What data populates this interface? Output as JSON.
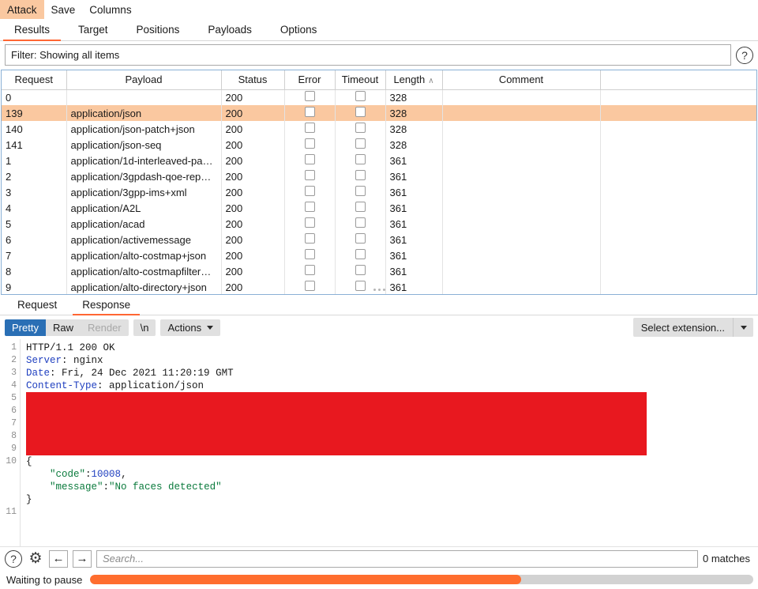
{
  "menubar": {
    "items": [
      {
        "label": "Attack",
        "active": true
      },
      {
        "label": "Save",
        "active": false
      },
      {
        "label": "Columns",
        "active": false
      }
    ]
  },
  "tabs": {
    "items": [
      {
        "label": "Results",
        "active": true
      },
      {
        "label": "Target",
        "active": false
      },
      {
        "label": "Positions",
        "active": false
      },
      {
        "label": "Payloads",
        "active": false
      },
      {
        "label": "Options",
        "active": false
      }
    ]
  },
  "filter": {
    "text": "Filter: Showing all items",
    "help_icon": "question-mark-icon",
    "help_glyph": "?"
  },
  "results_table": {
    "columns": [
      "Request",
      "Payload",
      "Status",
      "Error",
      "Timeout",
      "Length",
      "Comment"
    ],
    "sorted_column": "Length",
    "sort_caret": "∧",
    "rows": [
      {
        "request": "0",
        "payload": "",
        "status": "200",
        "length": "328",
        "comment": "",
        "selected": false
      },
      {
        "request": "139",
        "payload": "application/json",
        "status": "200",
        "length": "328",
        "comment": "",
        "selected": true
      },
      {
        "request": "140",
        "payload": "application/json-patch+json",
        "status": "200",
        "length": "328",
        "comment": "",
        "selected": false
      },
      {
        "request": "141",
        "payload": "application/json-seq",
        "status": "200",
        "length": "328",
        "comment": "",
        "selected": false
      },
      {
        "request": "1",
        "payload": "application/1d-interleaved-pa…",
        "status": "200",
        "length": "361",
        "comment": "",
        "selected": false
      },
      {
        "request": "2",
        "payload": "application/3gpdash-qoe-rep…",
        "status": "200",
        "length": "361",
        "comment": "",
        "selected": false
      },
      {
        "request": "3",
        "payload": "application/3gpp-ims+xml",
        "status": "200",
        "length": "361",
        "comment": "",
        "selected": false
      },
      {
        "request": "4",
        "payload": "application/A2L",
        "status": "200",
        "length": "361",
        "comment": "",
        "selected": false
      },
      {
        "request": "5",
        "payload": "application/acad",
        "status": "200",
        "length": "361",
        "comment": "",
        "selected": false
      },
      {
        "request": "6",
        "payload": "application/activemessage",
        "status": "200",
        "length": "361",
        "comment": "",
        "selected": false
      },
      {
        "request": "7",
        "payload": "application/alto-costmap+json",
        "status": "200",
        "length": "361",
        "comment": "",
        "selected": false
      },
      {
        "request": "8",
        "payload": "application/alto-costmapfilter…",
        "status": "200",
        "length": "361",
        "comment": "",
        "selected": false
      },
      {
        "request": "9",
        "payload": "application/alto-directory+json",
        "status": "200",
        "length": "361",
        "comment": "",
        "selected": false
      }
    ]
  },
  "message_tabs": {
    "items": [
      {
        "label": "Request",
        "active": false
      },
      {
        "label": "Response",
        "active": true
      }
    ]
  },
  "editor_toolbar": {
    "pretty": "Pretty",
    "raw": "Raw",
    "render": "Render",
    "newline": "\\n",
    "actions": "Actions",
    "select_extension": "Select extension..."
  },
  "response": {
    "lines": [
      {
        "num": "1",
        "type": "status",
        "text": "HTTP/1.1 200 OK"
      },
      {
        "num": "2",
        "type": "header",
        "name": "Server",
        "value": " nginx"
      },
      {
        "num": "3",
        "type": "header",
        "name": "Date",
        "value": " Fri, 24 Dec 2021 11:20:19 GMT"
      },
      {
        "num": "4",
        "type": "header",
        "name": "Content-Type",
        "value": " application/json"
      },
      {
        "num": "5",
        "type": "redacted",
        "text": ""
      },
      {
        "num": "6",
        "type": "redacted",
        "text": ""
      },
      {
        "num": "7",
        "type": "redacted",
        "text": ""
      },
      {
        "num": "8",
        "type": "redacted",
        "text": ""
      },
      {
        "num": "9",
        "type": "redacted",
        "text": ""
      },
      {
        "num": "10",
        "type": "plain",
        "text": "{"
      },
      {
        "num": "",
        "type": "json_num",
        "key": "\"code\"",
        "sep": ":",
        "value": "10008",
        "tail": ","
      },
      {
        "num": "",
        "type": "json_str",
        "key": "\"message\"",
        "sep": ":",
        "value": "\"No faces detected\"",
        "tail": ""
      },
      {
        "num": "",
        "type": "plain",
        "text": "}"
      },
      {
        "num": "11",
        "type": "plain",
        "text": ""
      }
    ],
    "redaction_color": "#e8181f"
  },
  "search": {
    "help_glyph": "?",
    "gear_glyph": "⚙",
    "back_glyph": "←",
    "forward_glyph": "→",
    "placeholder": "Search...",
    "value": "",
    "matches": "0 matches"
  },
  "status": {
    "label": "Waiting to pause",
    "progress_percent": 65,
    "progress_color": "#ff6d2e"
  },
  "theme": {
    "accent": "#ff6633",
    "highlight": "#fac8a0",
    "selected_blue": "#2a6fb5"
  }
}
